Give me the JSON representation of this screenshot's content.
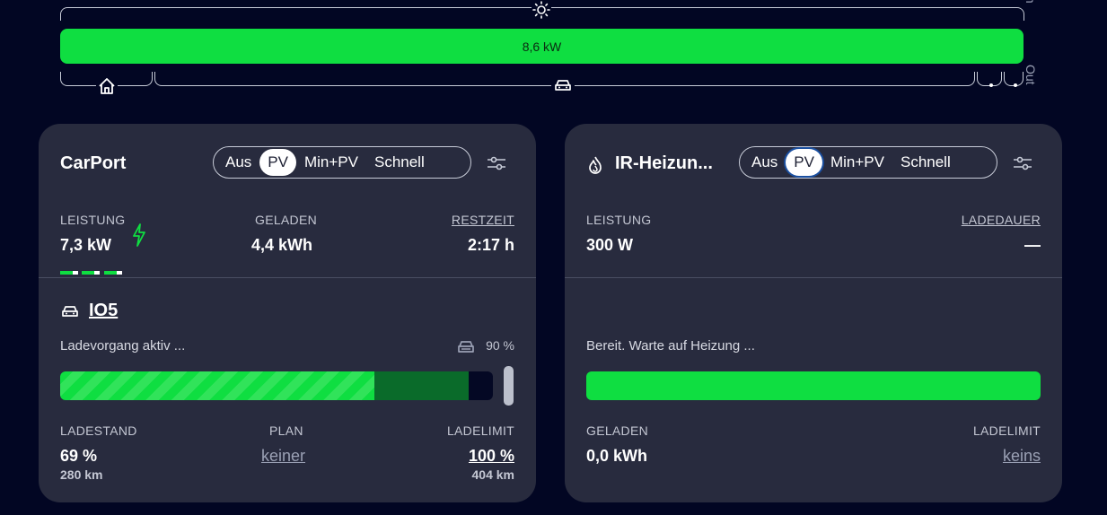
{
  "flow": {
    "pv_power": "8,6 kW",
    "in_label": "In",
    "out_label": "Out",
    "icons": [
      "sun-icon",
      "home-icon",
      "car-icon"
    ]
  },
  "carport": {
    "title": "CarPort",
    "modes": [
      "Aus",
      "PV",
      "Min+PV",
      "Schnell"
    ],
    "active_mode": "PV",
    "leistung_label": "LEISTUNG",
    "leistung_value": "7,3 kW",
    "geladen_label": "GELADEN",
    "geladen_value": "4,4 kWh",
    "restzeit_label": "RESTZEIT",
    "restzeit_value": "2:17 h",
    "vehicle_name": "IO5",
    "status": "Ladevorgang aktiv ...",
    "vehicle_limit": "90 %",
    "soc_fraction": 0.69,
    "ladestand_label": "LADESTAND",
    "ladestand_value": "69 %",
    "ladestand_range": "280 km",
    "plan_label": "PLAN",
    "plan_value": "keiner",
    "ladelimit_label": "LADELIMIT",
    "ladelimit_value": "100 %",
    "ladelimit_range": "404 km"
  },
  "heater": {
    "title": "IR-Heizun...",
    "modes": [
      "Aus",
      "PV",
      "Min+PV",
      "Schnell"
    ],
    "active_mode": "PV",
    "leistung_label": "LEISTUNG",
    "leistung_value": "300 W",
    "ladedauer_label": "LADEDAUER",
    "ladedauer_value": "—",
    "status": "Bereit. Warte auf Heizung ...",
    "geladen_label": "GELADEN",
    "geladen_value": "0,0 kWh",
    "ladelimit_label": "LADELIMIT",
    "ladelimit_value": "keins"
  },
  "colors": {
    "background": "#020623",
    "card": "#282b3e",
    "green": "#0fde41",
    "dark_green": "#0a6b2a"
  }
}
